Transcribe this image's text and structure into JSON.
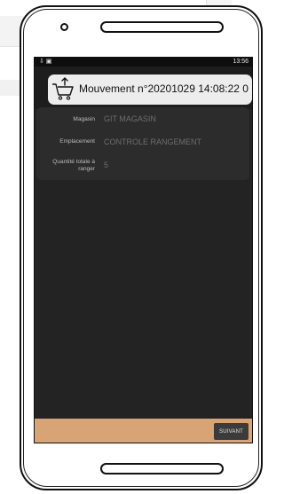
{
  "status_bar": {
    "icons": "⇩ ▣",
    "time": "13:56"
  },
  "header": {
    "icon": "shopping-cart-arrow-icon",
    "title": "Mouvement n°20201029 14:08:22 0"
  },
  "form": {
    "fields": [
      {
        "label": "Magasin",
        "value": "GIT MAGASIN"
      },
      {
        "label": "Emplacement",
        "value": "CONTROLE RANGEMENT"
      },
      {
        "label": "Quantité totale à ranger",
        "value": "5"
      }
    ]
  },
  "footer": {
    "next_label": "SUIVANT"
  },
  "colors": {
    "screen_bg": "#232323",
    "card_bg": "#2c2c2c",
    "footer_bg": "#d8a476",
    "button_bg": "#3b3b3b"
  }
}
